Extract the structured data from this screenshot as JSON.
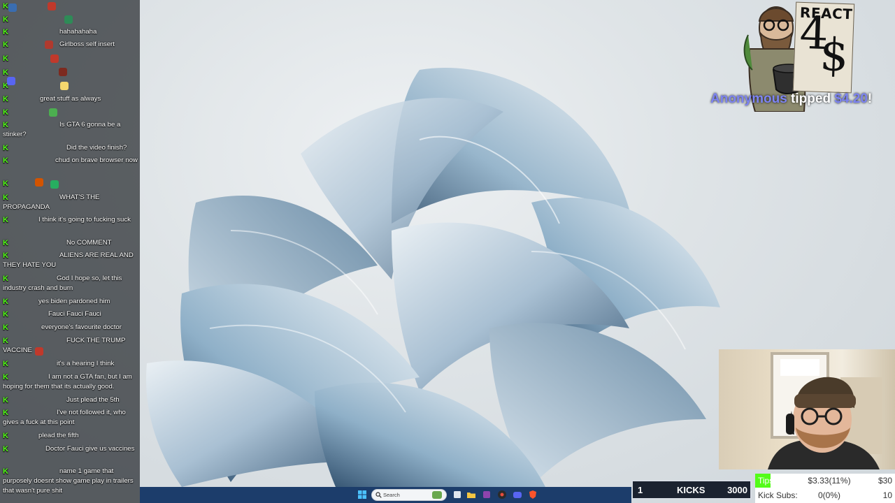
{
  "chat": {
    "messages": [
      {
        "user": "",
        "text": ""
      },
      {
        "user": "",
        "text": ""
      },
      {
        "user": "",
        "text": "hahahahaha"
      },
      {
        "user": "",
        "text": "Girlboss self insert"
      },
      {
        "user": "",
        "text": ""
      },
      {
        "user": "",
        "text": ""
      },
      {
        "user": "",
        "text": ""
      },
      {
        "user": "",
        "text": "great stuff as always"
      },
      {
        "user": "",
        "text": ""
      },
      {
        "user": "",
        "text": "Is GTA 6 gonna be a stinker?"
      },
      {
        "user": "",
        "text": "Did the video finish?"
      },
      {
        "user": "",
        "text": "chud on brave browser now"
      },
      {
        "user": "",
        "text": ""
      },
      {
        "user": "",
        "text": "WHAT'S THE PROPAGANDA"
      },
      {
        "user": "",
        "text": "I think it's going to fucking suck"
      },
      {
        "user": "",
        "text": "No COMMENT"
      },
      {
        "user": "",
        "text": "ALIENS ARE REAL AND THEY HATE YOU"
      },
      {
        "user": "",
        "text": "God I hope so, let this industry crash and burn"
      },
      {
        "user": "",
        "text": "yes biden pardoned him"
      },
      {
        "user": "",
        "text": "Fauci Fauci Fauci"
      },
      {
        "user": "",
        "text": "everyone's favourite doctor"
      },
      {
        "user": "",
        "text": "FUCK THE TRUMP VACCINE"
      },
      {
        "user": "",
        "text": "it's a hearing I think"
      },
      {
        "user": "",
        "text": "I am not a GTA fan, but I am hoping for them that its actually good."
      },
      {
        "user": "",
        "text": "Just plead the 5th"
      },
      {
        "user": "",
        "text": "I've not followed it, who gives a fuck at this point"
      },
      {
        "user": "",
        "text": "plead the fifth"
      },
      {
        "user": "",
        "text": "Doctor Fauci give us vaccines"
      },
      {
        "user": "",
        "text": "name 1 game that purposely doesnt show game play in trailers that wasn't pure shit"
      }
    ]
  },
  "tip_alert": {
    "card_title": "REACT",
    "card_number": "4",
    "card_symbol": "$",
    "name": "Anonymous",
    "verb": " tipped ",
    "amount": "$4.20",
    "suffix": "!"
  },
  "kicks": {
    "current": "1",
    "label": "KICKS",
    "goal": "3000"
  },
  "stats": {
    "tips_label": "Tips:",
    "tips_value": "$3.33(11%)",
    "tips_goal": "$30",
    "subs_label": "Kick Subs:",
    "subs_value": "0(0%)",
    "subs_goal": "10"
  },
  "taskbar": {
    "search_placeholder": "Search"
  },
  "colors": {
    "kick_green": "#53fc18",
    "chat_username": "#5b6cf0",
    "tip_accent": "#7d84f2",
    "taskbar": "#1c3d6b"
  }
}
